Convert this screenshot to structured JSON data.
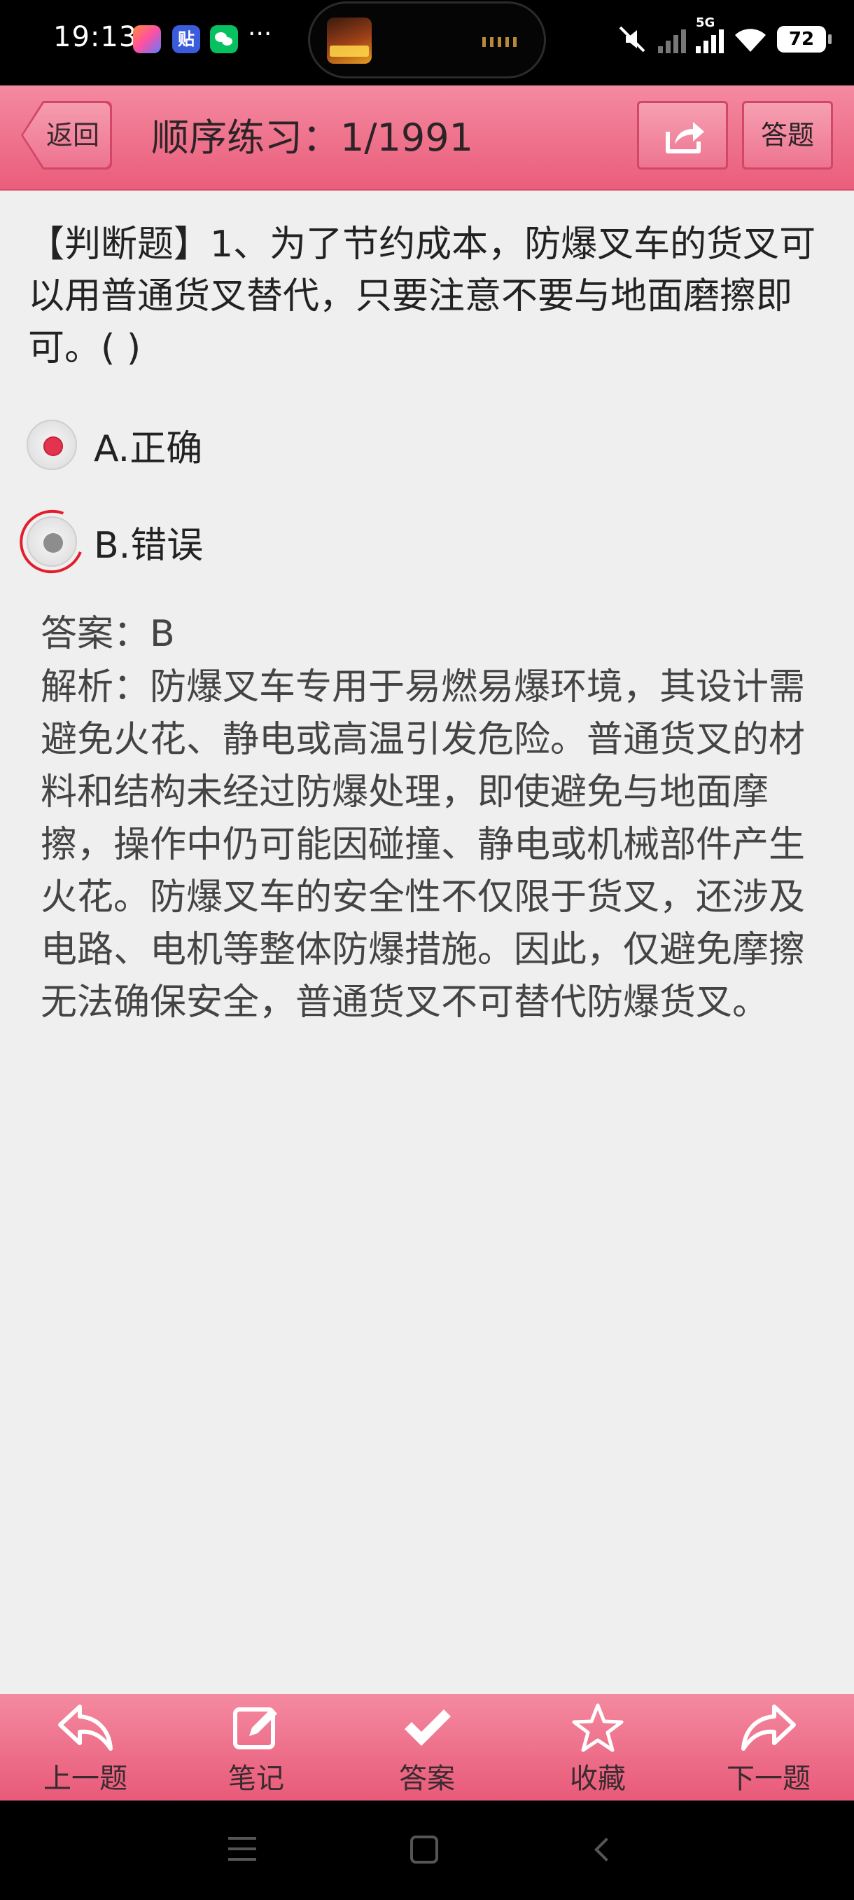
{
  "status_bar": {
    "time": "19:13",
    "tieba_label": "贴",
    "more": "···",
    "network": "5G",
    "battery": "72"
  },
  "header": {
    "back_label": "返回",
    "title": "顺序练习：1/1991",
    "answer_sheet_label": "答题",
    "accent_color": "#ea5d7b"
  },
  "question": {
    "text": "【判断题】1、为了节约成本，防爆叉车的货叉可以用普通货叉替代，只要注意不要与地面磨擦即可。( )",
    "options": [
      {
        "label": "A.正确",
        "selected": true
      },
      {
        "label": "B.错误",
        "selected": false
      }
    ],
    "answer": "答案：B",
    "analysis": "解析：防爆叉车专用于易燃易爆环境，其设计需避免火花、静电或高温引发危险。普通货叉的材料和结构未经过防爆处理，即使避免与地面摩擦，操作中仍可能因碰撞、静电或机械部件产生火花。防爆叉车的安全性不仅限于货叉，还涉及电路、电机等整体防爆措施。因此，仅避免摩擦无法确保安全，普通货叉不可替代防爆货叉。"
  },
  "toolbar": {
    "items": [
      {
        "label": "上一题",
        "icon": "reply-arrow-icon"
      },
      {
        "label": "笔记",
        "icon": "edit-note-icon"
      },
      {
        "label": "答案",
        "icon": "checkmark-icon"
      },
      {
        "label": "收藏",
        "icon": "star-icon"
      },
      {
        "label": "下一题",
        "icon": "forward-arrow-icon"
      }
    ]
  }
}
